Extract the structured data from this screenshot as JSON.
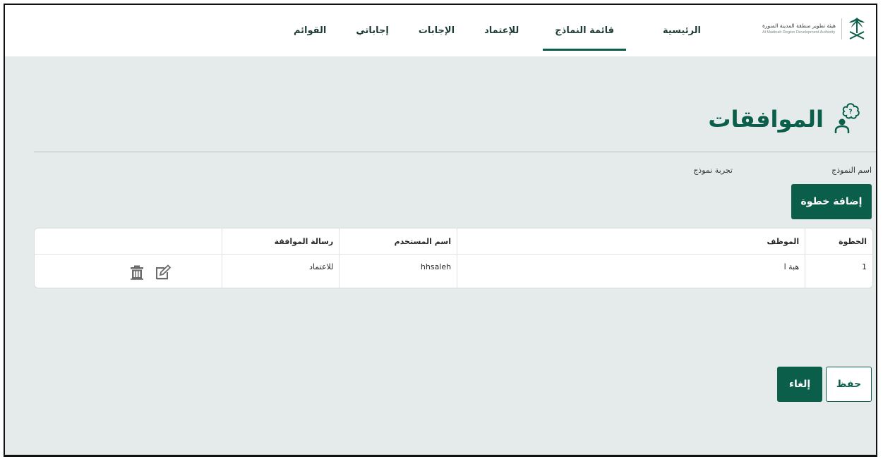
{
  "org": {
    "name_ar": "هيئة تطوير منطقة المدينة المنورة",
    "name_en": "Al Madinah Region Development Authority"
  },
  "nav": {
    "items": [
      {
        "label": "الرئيسية",
        "active": false
      },
      {
        "label": "قائمة النماذج",
        "active": true
      },
      {
        "label": "للإعتماد",
        "active": false
      },
      {
        "label": "الإجابات",
        "active": false
      },
      {
        "label": "إجاباتي",
        "active": false
      },
      {
        "label": "القوائم",
        "active": false
      }
    ]
  },
  "page": {
    "title": "الموافقات",
    "form_name_label": "اسم النموذج",
    "form_name_value": "تجربة نموذج",
    "add_step_label": "إضافة خطوة"
  },
  "table": {
    "headers": {
      "step": "الخطوة",
      "employee": "الموظف",
      "username": "اسم المستخدم",
      "approval_message": "رسالة الموافقة"
    },
    "rows": [
      {
        "step": "1",
        "employee": "هبة ا",
        "username": "hhsaleh",
        "approval_message": "للاعتماد",
        "edit_icon": "edit-icon",
        "delete_icon": "trash-icon"
      }
    ]
  },
  "actions": {
    "save_label": "حفظ",
    "cancel_label": "إلغاء"
  },
  "colors": {
    "primary": "#0b5e4a",
    "background": "#e5ebea",
    "header_bg": "#ffffff"
  }
}
